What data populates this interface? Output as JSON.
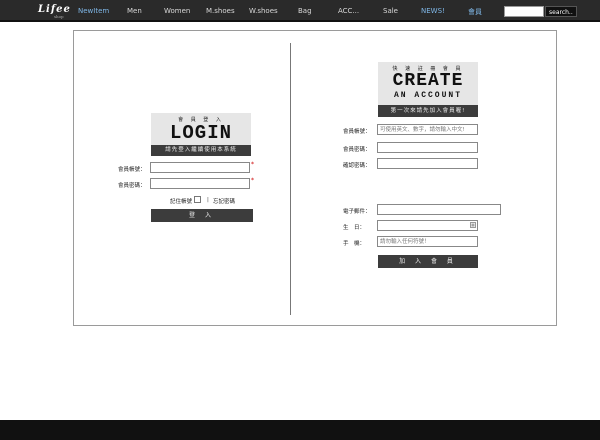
{
  "nav": {
    "logo": "Lifee",
    "logo_sub": "shop",
    "items": [
      {
        "label": "NewItem",
        "highlight": true
      },
      {
        "label": "Men",
        "highlight": false
      },
      {
        "label": "Women",
        "highlight": false
      },
      {
        "label": "M.shoes",
        "highlight": false
      },
      {
        "label": "W.shoes",
        "highlight": false
      },
      {
        "label": "Bag",
        "highlight": false
      },
      {
        "label": "ACC...",
        "highlight": false
      },
      {
        "label": "Sale",
        "highlight": false
      },
      {
        "label": "NEWS!",
        "highlight": true
      },
      {
        "label": "會員",
        "highlight": true
      }
    ],
    "search_value": "",
    "search_button": "search.."
  },
  "login": {
    "banner_small": "會 員 登 入",
    "banner_big": "LOGIN",
    "subtitle": "請先登入繼續使用本系統",
    "account_label": "會員帳號：",
    "password_label": "會員密碼：",
    "required_mark": "*",
    "remember_label": "記住帳號",
    "separator": "|",
    "forgot_label": "忘記密碼",
    "submit": "登 入"
  },
  "register": {
    "banner_small": "快 速 註 冊 會 員",
    "banner_big": "CREATE",
    "banner_sub": "AN ACCOUNT",
    "subtitle": "第一次來請先加入會員喔!",
    "account_label": "會員帳號：",
    "account_placeholder": "可使用英文、數字，請勿輸入中文!",
    "password_label": "會員密碼：",
    "confirm_label": "確認密碼：",
    "email_label": "電子郵件：",
    "birthday_label": "生　日：",
    "calendar_glyph": "▦",
    "phone_label": "手　機：",
    "phone_placeholder": "請勿輸入任何符號！",
    "submit": "加 入 會 員"
  },
  "colors": {
    "nav_bg": "#2a2a2a",
    "nav_highlight": "#7fb6e6",
    "dark_bar": "#3c3c3c",
    "banner_bg": "#e6e6e6",
    "required": "#cc0000"
  }
}
